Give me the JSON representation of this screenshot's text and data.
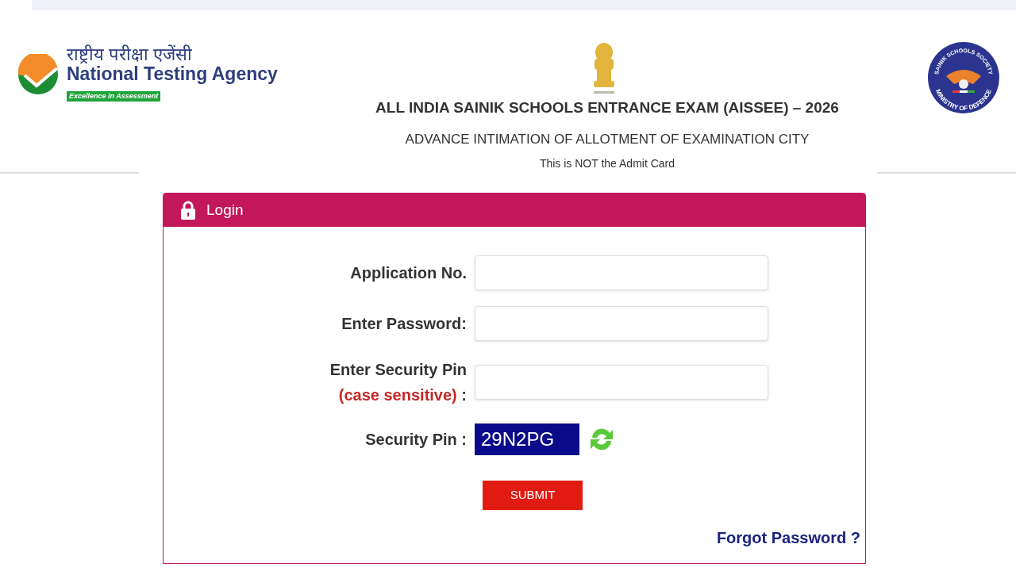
{
  "header": {
    "agency_hindi": "राष्ट्रीय परीक्षा एजेंसी",
    "agency_name": "National Testing Agency",
    "agency_tagline": "Excellence in Assessment",
    "society_logo_top": "SAINIK SCHOOLS SOCIETY",
    "society_logo_bottom": "MINISTRY OF DEFENCE",
    "exam_title": "ALL INDIA SAINIK SCHOOLS ENTRANCE EXAM (AISSEE) – 2026",
    "subtitle": "ADVANCE INTIMATION OF ALLOTMENT OF EXAMINATION CITY",
    "note": "This is NOT the Admit Card"
  },
  "login": {
    "title": "Login",
    "fields": [
      {
        "kind": "input",
        "label": "Application No."
      },
      {
        "kind": "input",
        "label": "Enter Password:"
      },
      {
        "kind": "input",
        "label": "Enter Security Pin",
        "hint": "(case sensitive)",
        "hint_suffix": ":"
      },
      {
        "kind": "captcha",
        "label": "Security Pin :",
        "code": "29N2PG"
      }
    ],
    "submit": "SUBMIT",
    "forgot": "Forgot Password ?"
  }
}
